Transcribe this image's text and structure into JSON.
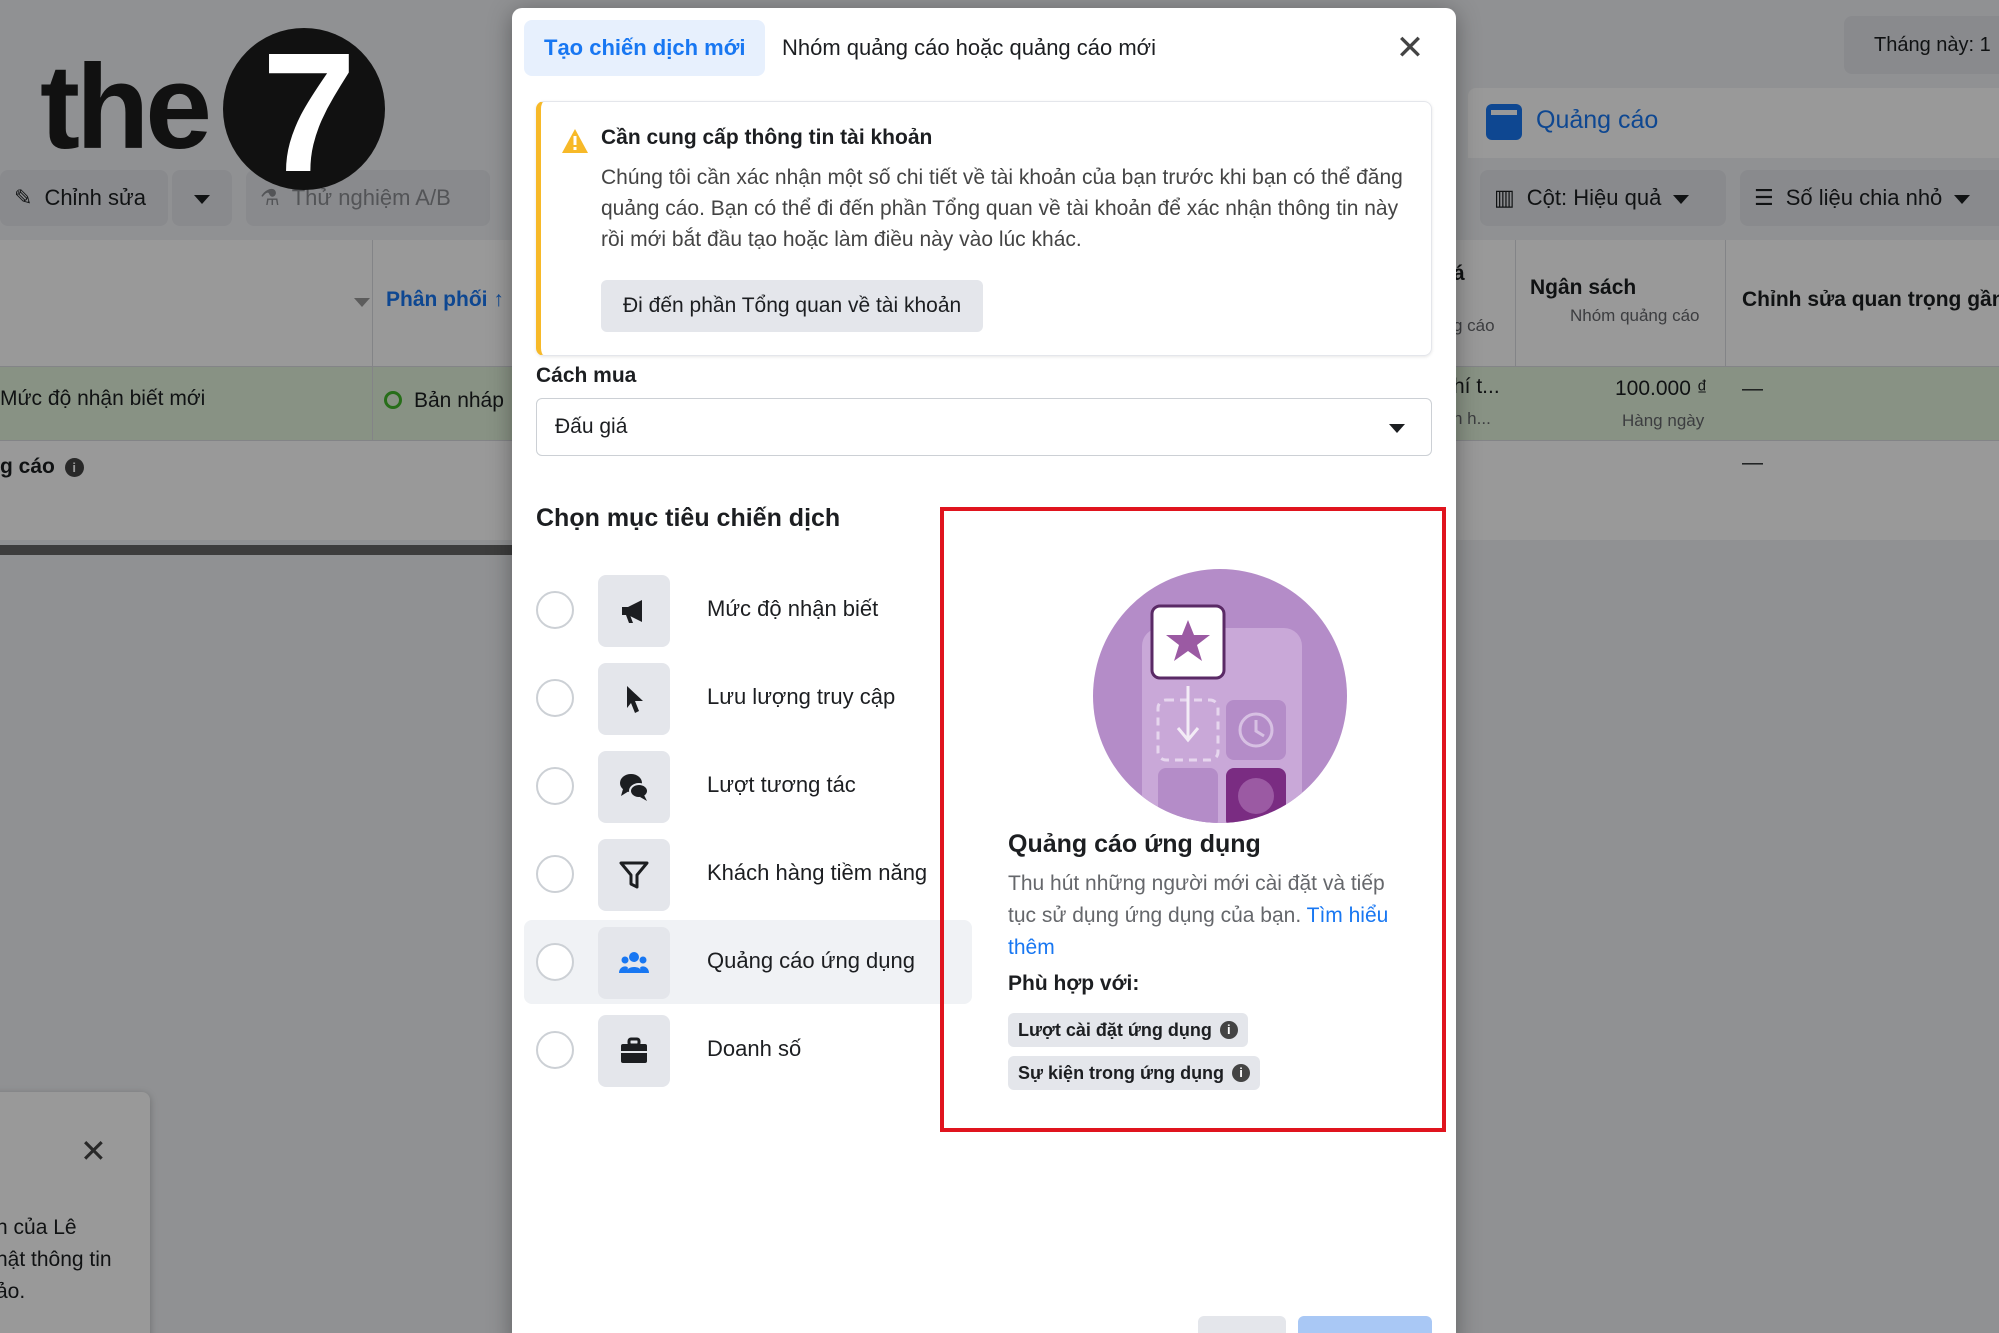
{
  "background": {
    "date_filter": "Tháng này: 1",
    "ads_tab": "Quảng cáo",
    "toolbar": {
      "edit_label": "Chỉnh sửa",
      "ab_test_label": "Thử nghiệm A/B",
      "columns_label": "Cột: Hiệu quả",
      "breakdown_label": "Số liệu chia nhỏ"
    },
    "table": {
      "col_delivery": "Phân phối ↑",
      "col_budget": "Ngân sách",
      "col_budget_sub": "Nhóm quảng cáo",
      "col_edits": "Chỉnh sửa quan trọng gần",
      "row_name": "Mức độ nhận biết mới",
      "row_status": "Bản nháp",
      "row_budget": "100.000 ₫",
      "row_budget_sub": "Hàng ngày",
      "row_edits": "—",
      "row_partial_a": "hí t...",
      "row_partial_b": "n h...",
      "col_partial_a": "á",
      "col_partial_b": "g cáo",
      "summary_label": "g cáo",
      "summary_edits": "—"
    },
    "notification": {
      "text_lines": [
        "n của Lê",
        "hật thông tin",
        "ảo."
      ]
    }
  },
  "logo": {
    "word": "the",
    "number": "7"
  },
  "dialog": {
    "tab_active": "Tạo chiến dịch mới",
    "tab_other": "Nhóm quảng cáo hoặc quảng cáo mới",
    "warning": {
      "title": "Cần cung cấp thông tin tài khoản",
      "body": "Chúng tôi cần xác nhận một số chi tiết về tài khoản của bạn trước khi bạn có thể đăng quảng cáo. Bạn có thể đi đến phần Tổng quan về tài khoản để xác nhận thông tin này rồi mới bắt đầu tạo hoặc làm điều này vào lúc khác.",
      "button": "Đi đến phần Tổng quan về tài khoản"
    },
    "buying": {
      "label": "Cách mua",
      "value": "Đấu giá"
    },
    "objective_title": "Chọn mục tiêu chiến dịch",
    "objectives": [
      {
        "label": "Mức độ nhận biết",
        "icon": "megaphone-icon"
      },
      {
        "label": "Lưu lượng truy cập",
        "icon": "cursor-icon"
      },
      {
        "label": "Lượt tương tác",
        "icon": "chat-bubbles-icon"
      },
      {
        "label": "Khách hàng tiềm năng",
        "icon": "funnel-icon"
      },
      {
        "label": "Quảng cáo ứng dụng",
        "icon": "people-icon",
        "selected": true
      },
      {
        "label": "Doanh số",
        "icon": "briefcase-icon"
      }
    ],
    "detail": {
      "title": "Quảng cáo ứng dụng",
      "desc": "Thu hút những người mới cài đặt và tiếp tục sử dụng ứng dụng của bạn.",
      "link": "Tìm hiểu thêm",
      "fit_label": "Phù hợp với:",
      "chips": [
        "Lượt cài đặt ứng dụng",
        "Sự kiện trong ứng dụng"
      ]
    }
  },
  "colors": {
    "accent": "#1877f2",
    "warning": "#f7b928",
    "highlight_box": "#e0141e",
    "illustration": "#b48cc8",
    "draft_green": "#e3f4dc"
  }
}
